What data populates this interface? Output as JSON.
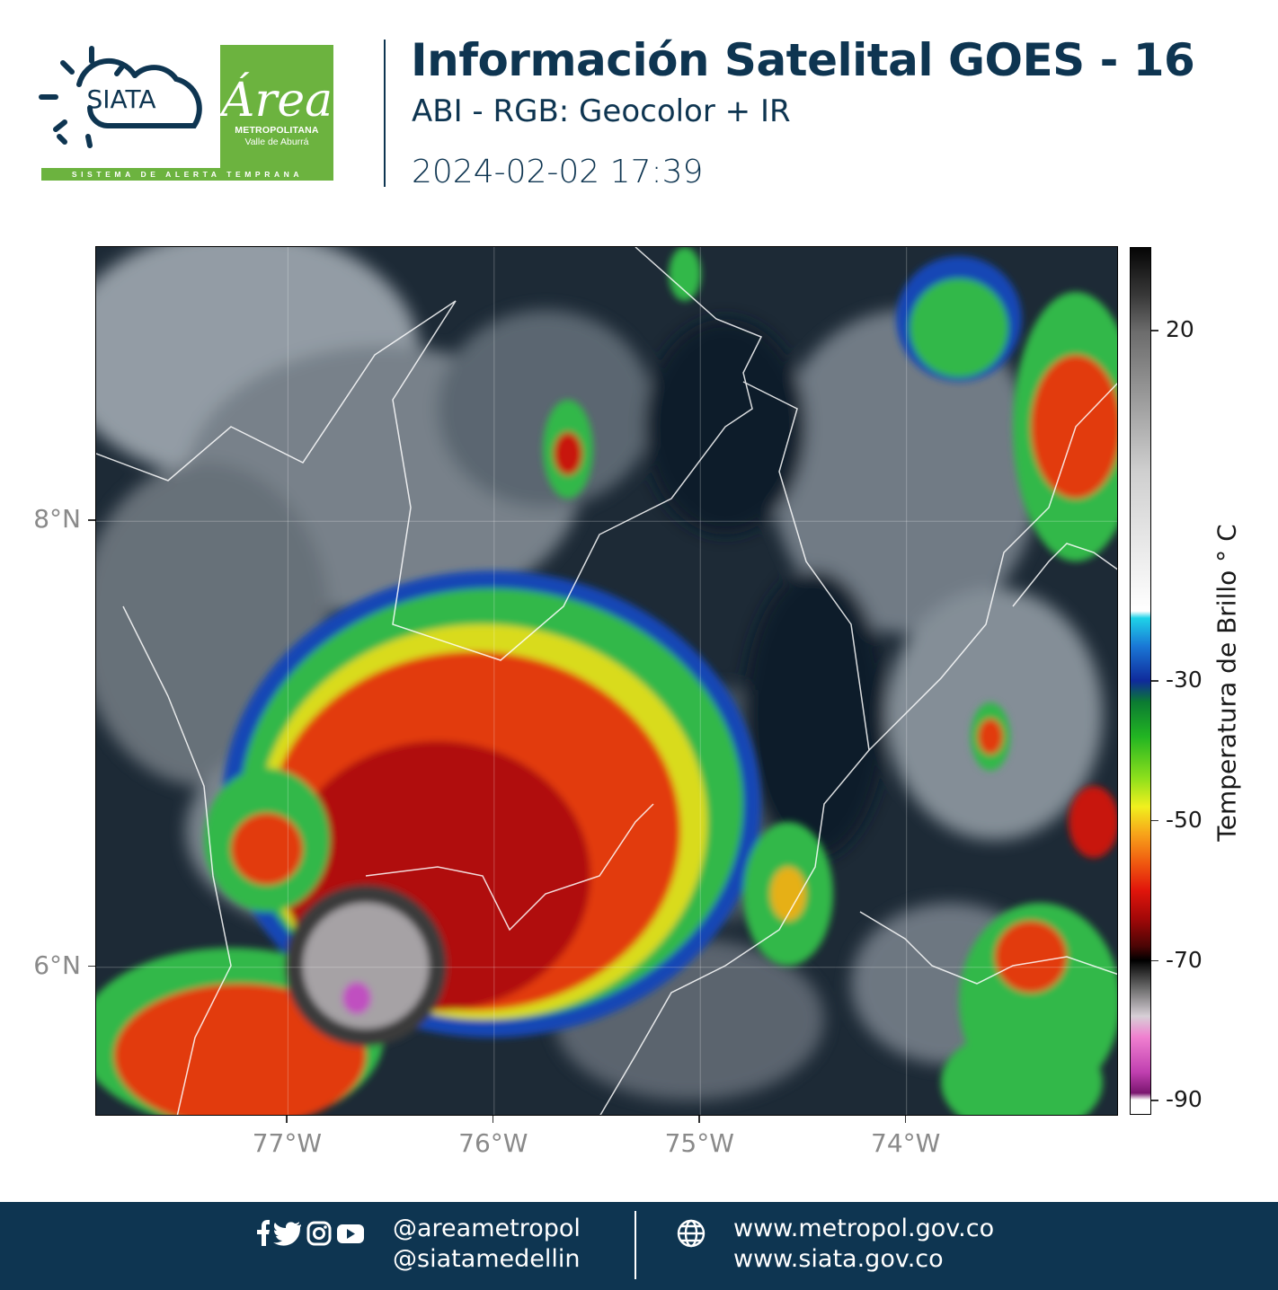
{
  "header": {
    "siata_logo_text": "SIATA",
    "area_logo": {
      "word": "Área",
      "line1": "METROPOLITANA",
      "line2": "Valle de Aburrá"
    },
    "alert_strip": "SISTEMA DE ALERTA TEMPRANA",
    "title": "Información Satelital GOES - 16",
    "subtitle": "ABI - RGB: Geocolor + IR",
    "timestamp": "2024-02-02 17:39"
  },
  "map": {
    "lat_ticks": [
      {
        "value": 8,
        "label": "8°N"
      },
      {
        "value": 6,
        "label": "6°N"
      }
    ],
    "lon_ticks": [
      {
        "value": -77,
        "label": "77°W"
      },
      {
        "value": -76,
        "label": "76°W"
      },
      {
        "value": -75,
        "label": "75°W"
      },
      {
        "value": -74,
        "label": "74°W"
      }
    ],
    "lon_range": [
      -77.93,
      -72.97
    ],
    "lat_range": [
      5.33,
      9.23
    ]
  },
  "colorbar": {
    "title": "Temperatura de Brillo ° C",
    "range": [
      -92,
      32
    ],
    "ticks": [
      {
        "value": 20,
        "label": "20"
      },
      {
        "value": -30,
        "label": "-30"
      },
      {
        "value": -50,
        "label": "-50"
      },
      {
        "value": -70,
        "label": "-70"
      },
      {
        "value": -90,
        "label": "-90"
      }
    ]
  },
  "footer": {
    "handle1": "@areametropol",
    "handle2": "@siatamedellin",
    "url1": "www.metropol.gov.co",
    "url2": "www.siata.gov.co",
    "social_icons": [
      "facebook-icon",
      "twitter-icon",
      "instagram-icon",
      "youtube-icon"
    ],
    "web_icon": "globe-icon"
  },
  "colors": {
    "navy": "#0e3551",
    "green": "#6cb33f"
  }
}
